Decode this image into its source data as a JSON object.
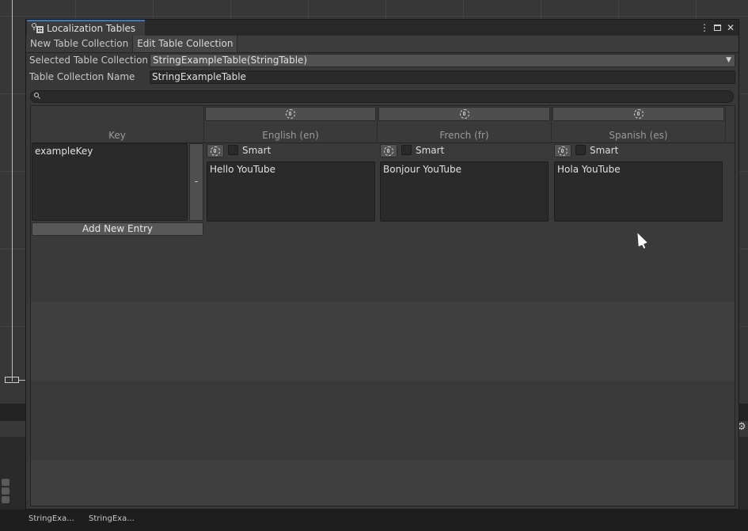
{
  "window": {
    "title": "Localization Tables",
    "controls": {
      "more": "⋮",
      "maximize": "",
      "close": "✕"
    }
  },
  "toolbar": {
    "tabs": [
      {
        "label": "New Table Collection",
        "selected": false
      },
      {
        "label": "Edit Table Collection",
        "selected": true
      }
    ]
  },
  "form": {
    "selected_collection_label": "Selected Table Collection",
    "selected_collection_value": "StringExampleTable(StringTable)",
    "collection_name_label": "Table Collection Name",
    "collection_name_value": "StringExampleTable"
  },
  "search": {
    "placeholder": ""
  },
  "table": {
    "key_header": "Key",
    "columns": [
      {
        "label": "English (en)"
      },
      {
        "label": "French (fr)"
      },
      {
        "label": "Spanish (es)"
      }
    ],
    "rows": [
      {
        "key": "exampleKey",
        "remove_label": "-",
        "cells": [
          {
            "smart_label": "Smart",
            "smart": false,
            "value": "Hello YouTube"
          },
          {
            "smart_label": "Smart",
            "smart": false,
            "value": "Bonjour YouTube"
          },
          {
            "smart_label": "Smart",
            "smart": false,
            "value": "Hola YouTube"
          }
        ]
      }
    ],
    "add_entry_label": "Add New Entry"
  },
  "assets": [
    {
      "label": "StringExa..."
    },
    {
      "label": "StringExa..."
    }
  ],
  "colors": {
    "accent": "#3a79bb",
    "window_bg": "#383838",
    "field_bg": "#2a2a2a"
  },
  "icons": {
    "tab": "localization-tables-icon",
    "locale": "locale-gear-icon",
    "search": "search-icon"
  }
}
